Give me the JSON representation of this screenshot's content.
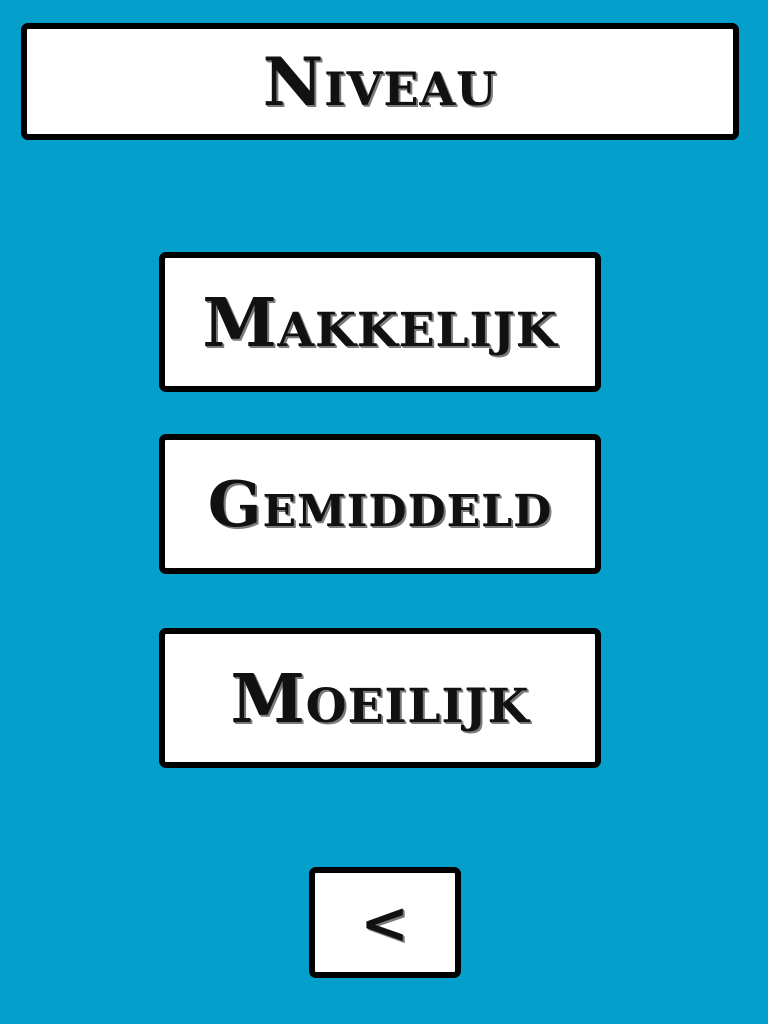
{
  "header": {
    "title": "Niveau"
  },
  "levels": [
    {
      "label": "Makkelijk"
    },
    {
      "label": "Gemiddeld"
    },
    {
      "label": "Moeilijk"
    }
  ],
  "navigation": {
    "back_label": "<"
  },
  "colors": {
    "background": "#059fcb",
    "panel": "#ffffff",
    "border": "#000000",
    "text": "#111111"
  }
}
